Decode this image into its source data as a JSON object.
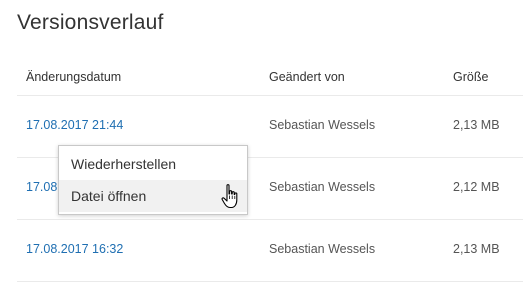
{
  "page": {
    "title": "Versionsverlauf"
  },
  "table": {
    "columns": [
      "Änderungsdatum",
      "Geändert von",
      "Größe"
    ],
    "rows": [
      {
        "date": "17.08.2017 21:44",
        "author": "Sebastian Wessels",
        "size": "2,13 MB"
      },
      {
        "date": "17.08.",
        "author": "Sebastian Wessels",
        "size": "2,12 MB"
      },
      {
        "date": "17.08.2017 16:32",
        "author": "Sebastian Wessels",
        "size": "2,13 MB"
      }
    ]
  },
  "context_menu": {
    "items": [
      {
        "label": "Wiederherstellen"
      },
      {
        "label": "Datei öffnen",
        "hovered": true
      }
    ]
  },
  "colors": {
    "link": "#1f6fb2",
    "text": "#333333",
    "muted": "#555555",
    "divider": "#eaeaea",
    "menu_hover": "#f1f1f1"
  },
  "icons": {
    "cursor": "hand-pointer-icon"
  }
}
